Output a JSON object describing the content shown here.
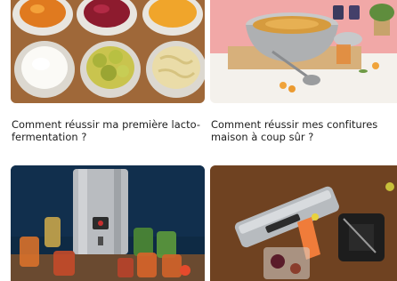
{
  "articles": [
    {
      "title": "Comment réussir ma première lacto-fermentation ?",
      "image": "fermentation-bowls-photo"
    },
    {
      "title": "Comment réussir mes confitures maison à coup sûr ?",
      "image": "jam-pot-photo"
    },
    {
      "title": "",
      "image": "sterilizer-jars-photo"
    },
    {
      "title": "",
      "image": "vacuum-sealer-photo"
    }
  ]
}
